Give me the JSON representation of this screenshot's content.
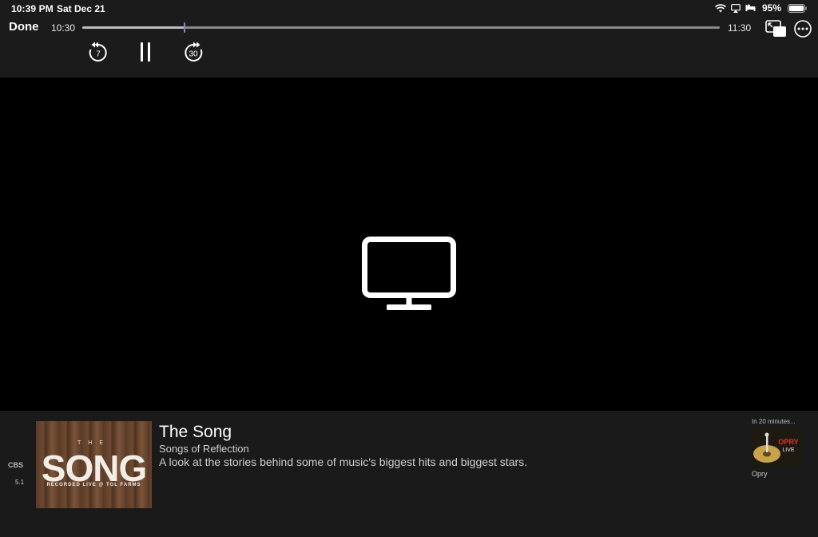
{
  "status_bar": {
    "time": "10:39 PM",
    "date": "Sat Dec 21",
    "battery_percent": "95%",
    "icons": [
      "wifi-icon",
      "airplay-icon",
      "sleep-icon",
      "battery-icon"
    ]
  },
  "player": {
    "done_label": "Done",
    "start_time": "10:30",
    "end_time": "11:30",
    "progress_fraction": 0.16,
    "skip_back_seconds": "7",
    "skip_forward_seconds": "30",
    "accent_color": "#8c7bd8"
  },
  "program": {
    "channel_logo": "CBS",
    "channel_number": "5.1",
    "title": "The Song",
    "episode": "Songs of Reflection",
    "description": "A look at the stories behind some of music's biggest hits and biggest stars.",
    "poster": {
      "top_text": "THE",
      "main_text": "SONG",
      "bottom_text": "RECORDED LIVE @ TGL FARMS"
    }
  },
  "up_next": {
    "label": "In 20 minutes...",
    "title": "Opry",
    "thumb_text_1": "OPRY",
    "thumb_text_2": "LIVE"
  }
}
